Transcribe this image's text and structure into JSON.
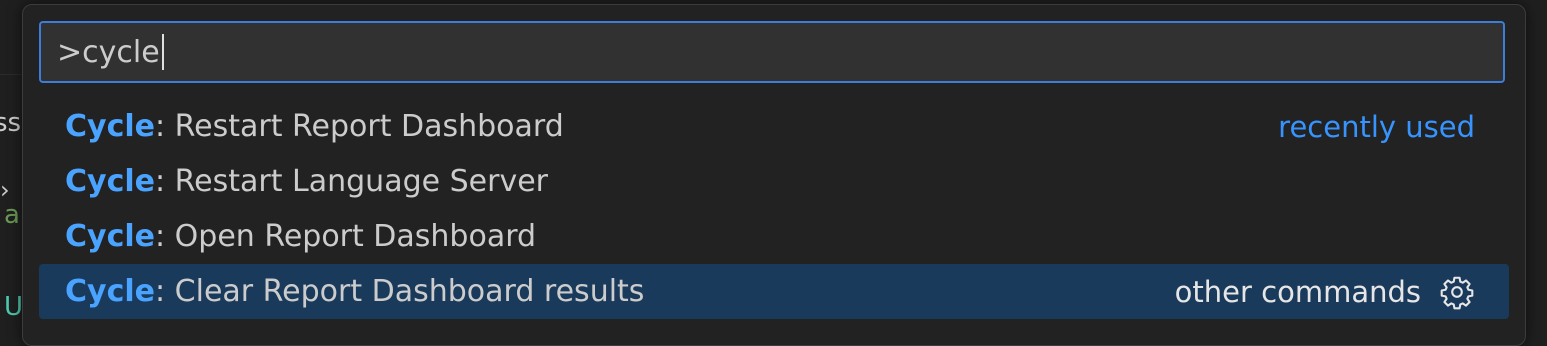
{
  "background": {
    "fragment_1": "ss",
    "fragment_2": "a",
    "fragment_3": "U",
    "chevron": "›"
  },
  "palette": {
    "input": {
      "value": ">cycle"
    },
    "items": [
      {
        "category": "Cycle",
        "separator": ": ",
        "title": "Restart Report Dashboard",
        "tag": "recently used"
      },
      {
        "category": "Cycle",
        "separator": ": ",
        "title": "Restart Language Server",
        "tag": ""
      },
      {
        "category": "Cycle",
        "separator": ": ",
        "title": "Open Report Dashboard",
        "tag": ""
      },
      {
        "category": "Cycle",
        "separator": ": ",
        "title": "Clear Report Dashboard results",
        "tag": "other commands",
        "selected": true,
        "icon": "gear-icon"
      }
    ]
  },
  "colors": {
    "accent": "#3794ff",
    "highlight": "#4aa3ff",
    "selected_bg": "#1a3a5c",
    "input_border": "#3b7dd8"
  }
}
